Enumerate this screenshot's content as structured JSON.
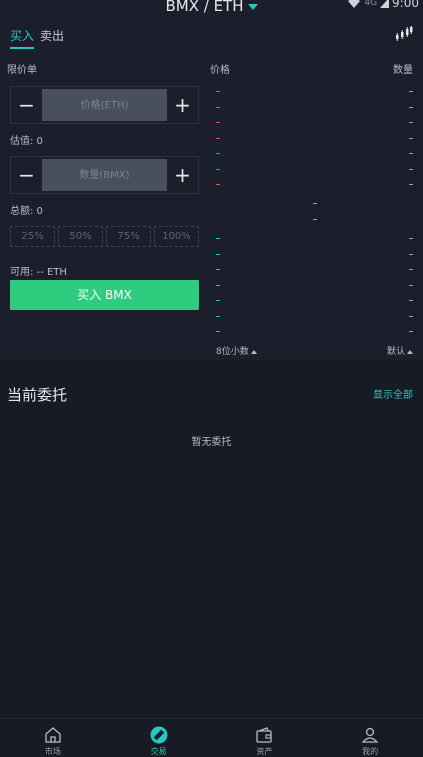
{
  "header": {
    "pair": "BMX / ETH",
    "status": {
      "network": "4G",
      "time": "9:00"
    }
  },
  "tabs": [
    {
      "label": "买入",
      "active": true
    },
    {
      "label": "卖出",
      "active": false
    }
  ],
  "form": {
    "order_type": "限价单",
    "price_placeholder": "价格(ETH)",
    "estimate_label": "估值: 0",
    "amount_placeholder": "数量(BMX)",
    "total_label": "总额: 0",
    "percents": [
      "25%",
      "50%",
      "75%",
      "100%"
    ],
    "available_label": "可用: -- ETH",
    "buy_button": "买入 BMX",
    "minus": "−",
    "plus": "+"
  },
  "orderbook": {
    "price_header": "价格",
    "amount_header": "数量",
    "decimals_label": "8位小数",
    "sort_label": "默认"
  },
  "orders": {
    "title": "当前委托",
    "show_all": "显示全部",
    "empty": "暂无委托"
  },
  "nav": [
    {
      "label": "市场",
      "icon": "home-icon",
      "active": false
    },
    {
      "label": "交易",
      "icon": "trade-icon",
      "active": true
    },
    {
      "label": "资产",
      "icon": "wallet-icon",
      "active": false
    },
    {
      "label": "我的",
      "icon": "user-icon",
      "active": false
    }
  ],
  "colors": {
    "accent": "#29c7c0",
    "buy": "#2ecc7f",
    "sell": "#d8566a",
    "background": "#171b26"
  }
}
